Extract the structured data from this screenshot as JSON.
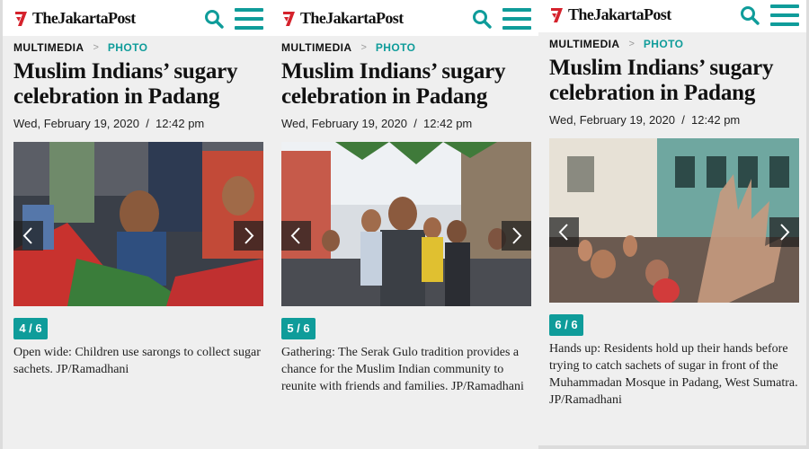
{
  "colors": {
    "accent": "#0f9c9a",
    "logo_red": "#d5222c",
    "panel_bg": "#efefef",
    "header_bg": "#ffffff"
  },
  "icons": {
    "logo": "jakarta-post-logo-icon",
    "search": "search-icon",
    "menu": "hamburger-menu-icon",
    "prev": "chevron-left-icon",
    "next": "chevron-right-icon"
  },
  "panels": [
    {
      "logo_text": "TheJakartaPost",
      "breadcrumb": {
        "section": "MULTIMEDIA",
        "separator": ">",
        "category": "PHOTO"
      },
      "title": "Muslim Indians’ sugary celebration in Padang",
      "date": "Wed, February 19, 2020",
      "date_separator": "/",
      "time": "12:42 pm",
      "counter": "4 / 6",
      "caption": "Open wide: Children use sarongs to collect sugar sachets. JP/Ramadhani"
    },
    {
      "logo_text": "TheJakartaPost",
      "breadcrumb": {
        "section": "MULTIMEDIA",
        "separator": ">",
        "category": "PHOTO"
      },
      "title": "Muslim Indians’ sugary celebration in Padang",
      "date": "Wed, February 19, 2020",
      "date_separator": "/",
      "time": "12:42 pm",
      "counter": "5 / 6",
      "caption": "Gathering: The Serak Gulo tradition provides a chance for the Muslim Indian community to reunite with friends and families. JP/Ramadhani"
    },
    {
      "logo_text": "TheJakartaPost",
      "breadcrumb": {
        "section": "MULTIMEDIA",
        "separator": ">",
        "category": "PHOTO"
      },
      "title": "Muslim Indians’ sugary celebration in Padang",
      "date": "Wed, February 19, 2020",
      "date_separator": "/",
      "time": "12:42 pm",
      "counter": "6 / 6",
      "caption": "Hands up: Residents hold up their hands before trying to catch sachets of sugar in front of the Muhammadan Mosque in Padang, West Sumatra. JP/Ramadhani"
    }
  ]
}
